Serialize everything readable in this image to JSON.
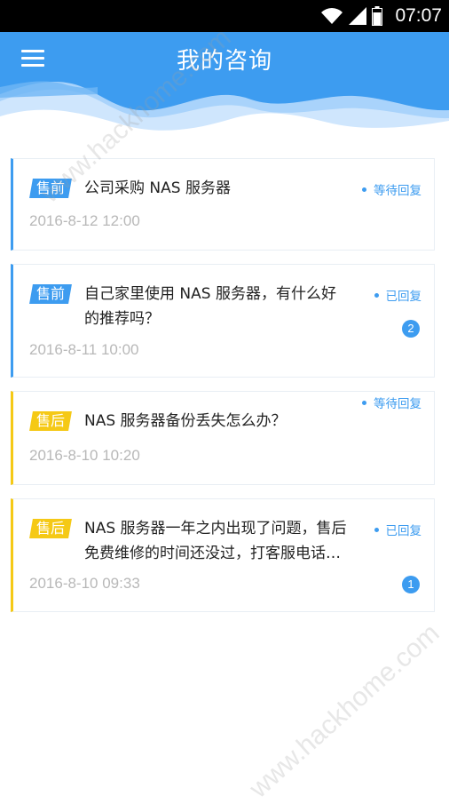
{
  "status_bar": {
    "time": "07:07"
  },
  "header": {
    "title": "我的咨询",
    "menu_icon": "hamburger-menu-icon"
  },
  "colors": {
    "primary": "#3d9cf0",
    "pre_sale": "#3d9cf0",
    "after_sale": "#f5c916"
  },
  "consultations": [
    {
      "tag": "售前",
      "subject": "公司采购 NAS 服务器",
      "datetime": "2016-8-12 12:00",
      "status": "等待回复"
    },
    {
      "tag": "售前",
      "subject_line1": "自己家里使用 NAS 服务器，有什么好",
      "subject_line2": "的推荐吗？",
      "datetime": "2016-8-11 10:00",
      "status": "已回复",
      "badge": "2"
    },
    {
      "tag": "售后",
      "subject": "NAS 服务器备份丢失怎么办？",
      "datetime": "2016-8-10 10:20",
      "status": "等待回复"
    },
    {
      "tag": "售后",
      "subject_line1": "NAS 服务器一年之内出现了问题，售后",
      "subject_line2": "免费维修的时间还没过，打客服电话…",
      "datetime": "2016-8-10 09:33",
      "status": "已回复",
      "badge": "1"
    }
  ],
  "watermark": "www.hackhome.com"
}
